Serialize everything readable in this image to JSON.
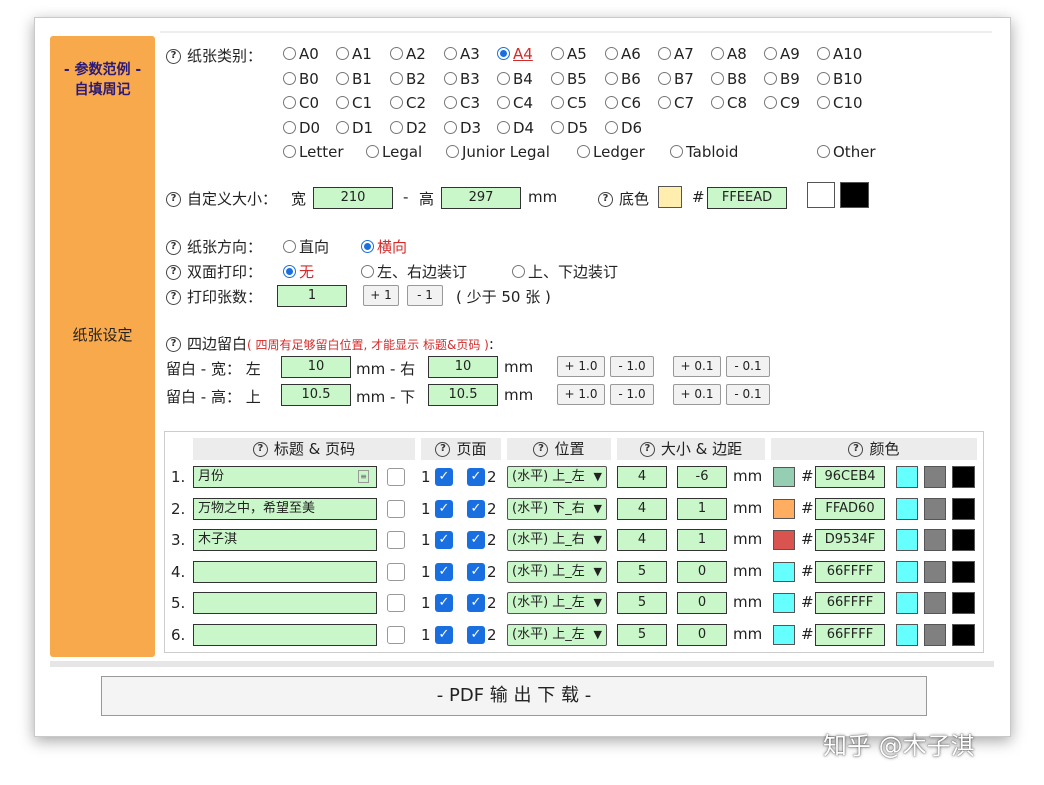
{
  "sidebar": {
    "title_line1": "- 参数范例 -",
    "title_line2": "自填周记",
    "section_label": "纸张设定"
  },
  "paper_type": {
    "label": "纸张类别：",
    "rows": [
      [
        "A0",
        "A1",
        "A2",
        "A3",
        "A4",
        "A5",
        "A6",
        "A7",
        "A8",
        "A9",
        "A10"
      ],
      [
        "B0",
        "B1",
        "B2",
        "B3",
        "B4",
        "B5",
        "B6",
        "B7",
        "B8",
        "B9",
        "B10"
      ],
      [
        "C0",
        "C1",
        "C2",
        "C3",
        "C4",
        "C5",
        "C6",
        "C7",
        "C8",
        "C9",
        "C10"
      ],
      [
        "D0",
        "D1",
        "D2",
        "D3",
        "D4",
        "D5",
        "D6"
      ]
    ],
    "named": [
      "Letter",
      "Legal",
      "Junior Legal",
      "Ledger",
      "Tabloid"
    ],
    "other": "Other",
    "selected": "A4"
  },
  "custom_size": {
    "label": "自定义大小：",
    "width_label": "宽",
    "width": "210",
    "dash": "-",
    "height_label": "高",
    "height": "297",
    "unit": "mm",
    "bg_label": "底色",
    "hash": "#",
    "bg_color": "FFEEAD",
    "bg_swatch": "#FFEEAD"
  },
  "orientation": {
    "label": "纸张方向：",
    "portrait": "直向",
    "landscape": "横向",
    "selected": "landscape"
  },
  "duplex": {
    "label": "双面打印：",
    "none": "无",
    "lr": "左、右边装订",
    "tb": "上、下边装订",
    "selected": "none"
  },
  "copies": {
    "label": "打印张数：",
    "value": "1",
    "plus": "+ 1",
    "minus": "- 1",
    "note": "( 少于 50 张 )"
  },
  "margins": {
    "label": "四边留白",
    "note": "( 四周有足够留白位置, 才能显示 标题&页码 )",
    "colon": ":",
    "w_label": "留白 - 宽： 左",
    "left": "10",
    "mm_dash_right": "mm - 右",
    "right": "10",
    "mm": "mm",
    "h_label": "留白 - 高： 上",
    "top": "10.5",
    "mm_dash_bottom": "mm - 下",
    "bottom": "10.5",
    "btn_p1": "+ 1.0",
    "btn_m1": "- 1.0",
    "btn_p01": "+ 0.1",
    "btn_m01": "- 0.1"
  },
  "table": {
    "headers": [
      "标题 & 页码",
      "页面",
      "位置",
      "大小 & 边距",
      "颜色"
    ],
    "rows": [
      {
        "num": "1.",
        "title": "月份",
        "p1": "1",
        "p2": "2",
        "pos": "(水平) 上_左",
        "size": "4",
        "margin": "-6",
        "mm": "mm",
        "hash": "#",
        "color": "96CEB4",
        "swatch": "#96CEB4"
      },
      {
        "num": "2.",
        "title": "万物之中，希望至美",
        "p1": "1",
        "p2": "2",
        "pos": "(水平) 下_右",
        "size": "4",
        "margin": "1",
        "mm": "mm",
        "hash": "#",
        "color": "FFAD60",
        "swatch": "#FFAD60"
      },
      {
        "num": "3.",
        "title": "木子淇",
        "p1": "1",
        "p2": "2",
        "pos": "(水平) 上_右",
        "size": "4",
        "margin": "1",
        "mm": "mm",
        "hash": "#",
        "color": "D9534F",
        "swatch": "#D9534F"
      },
      {
        "num": "4.",
        "title": "",
        "p1": "1",
        "p2": "2",
        "pos": "(水平) 上_左",
        "size": "5",
        "margin": "0",
        "mm": "mm",
        "hash": "#",
        "color": "66FFFF",
        "swatch": "#66FFFF"
      },
      {
        "num": "5.",
        "title": "",
        "p1": "1",
        "p2": "2",
        "pos": "(水平) 上_左",
        "size": "5",
        "margin": "0",
        "mm": "mm",
        "hash": "#",
        "color": "66FFFF",
        "swatch": "#66FFFF"
      },
      {
        "num": "6.",
        "title": "",
        "p1": "1",
        "p2": "2",
        "pos": "(水平) 上_左",
        "size": "5",
        "margin": "0",
        "mm": "mm",
        "hash": "#",
        "color": "66FFFF",
        "swatch": "#66FFFF"
      }
    ],
    "quick_colors": [
      "#66FFFF",
      "#808080",
      "#000000"
    ]
  },
  "download_button": "- PDF 输 出 下 载 -",
  "watermark": "知乎 @木子淇"
}
